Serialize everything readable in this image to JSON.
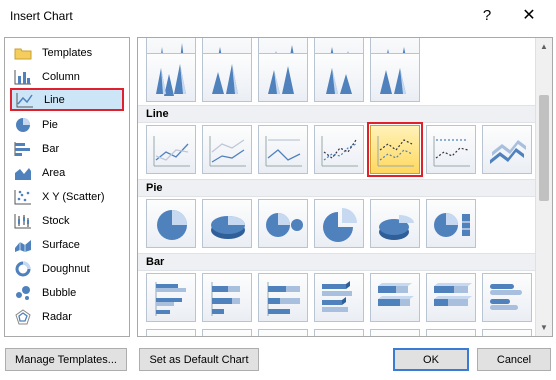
{
  "window": {
    "title": "Insert Chart",
    "help_glyph": "?",
    "close_glyph": "✕"
  },
  "categories": [
    {
      "label": "Templates",
      "icon": "folder-icon"
    },
    {
      "label": "Column",
      "icon": "column-chart-icon"
    },
    {
      "label": "Line",
      "icon": "line-chart-icon",
      "selected": true
    },
    {
      "label": "Pie",
      "icon": "pie-chart-icon"
    },
    {
      "label": "Bar",
      "icon": "bar-chart-icon"
    },
    {
      "label": "Area",
      "icon": "area-chart-icon"
    },
    {
      "label": "X Y (Scatter)",
      "icon": "scatter-chart-icon"
    },
    {
      "label": "Stock",
      "icon": "stock-chart-icon"
    },
    {
      "label": "Surface",
      "icon": "surface-chart-icon"
    },
    {
      "label": "Doughnut",
      "icon": "doughnut-chart-icon"
    },
    {
      "label": "Bubble",
      "icon": "bubble-chart-icon"
    },
    {
      "label": "Radar",
      "icon": "radar-chart-icon"
    }
  ],
  "gallery": {
    "sections": [
      {
        "title": "Line",
        "subtypes": [
          "line",
          "stacked-line",
          "100-stacked-line",
          "line-with-markers",
          "stacked-line-with-markers",
          "100-stacked-line-with-markers",
          "3d-line"
        ],
        "selected_index": 4
      },
      {
        "title": "Pie",
        "subtypes": [
          "pie",
          "3d-pie",
          "pie-of-pie",
          "exploded-pie",
          "exploded-3d-pie",
          "bar-of-pie"
        ]
      },
      {
        "title": "Bar",
        "subtypes": [
          "clustered-bar",
          "stacked-bar",
          "100-stacked-bar",
          "3d-clustered-bar",
          "3d-stacked-bar",
          "3d-100-stacked-bar",
          "clustered-horizontal-cylinder"
        ]
      }
    ],
    "colors": {
      "selection_outline": "#e0202a",
      "selected_fill": "#ffd85f",
      "chart_blue": "#4f81bd"
    }
  },
  "buttons": {
    "manage_templates": "Manage Templates...",
    "set_default": "Set as Default Chart",
    "ok": "OK",
    "cancel": "Cancel"
  }
}
